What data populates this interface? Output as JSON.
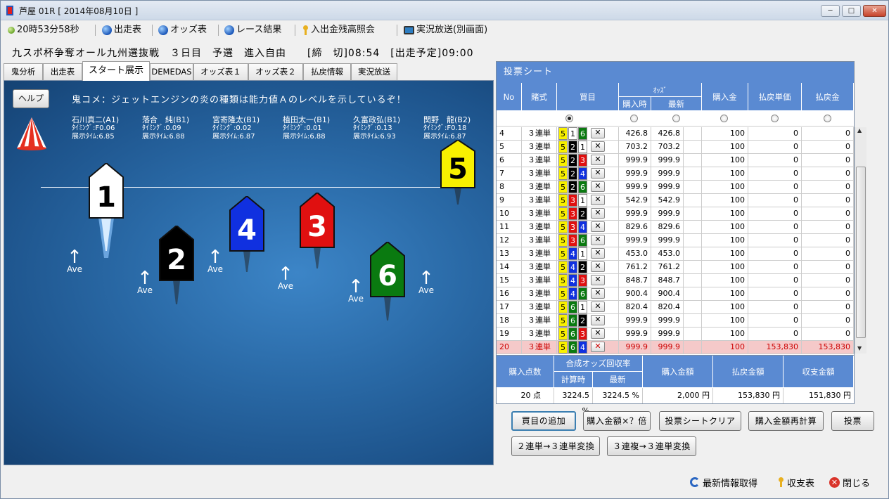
{
  "window": {
    "title": "芦屋 01R [ 2014年08月10日 ]",
    "min": "─",
    "max": "□",
    "close": "✕"
  },
  "toolbar": {
    "clock": "20時53分58秒",
    "entry_table": "出走表",
    "odds_table": "オッズ表",
    "race_result": "レース結果",
    "balance": "入出金残高照会",
    "live": "実況放送(別画面)"
  },
  "race_info": "九スポ杯争奪オール九州選抜戦　３日目　予選　進入自由　　[締　切]08:54　[出走予定]09:00",
  "tabs": [
    "鬼分析",
    "出走表",
    "スタート展示",
    "DEMEDAS",
    "オッズ表１",
    "オッズ表２",
    "払戻情報",
    "実況放送"
  ],
  "scene": {
    "help": "ヘルプ",
    "comment": "鬼コメ：ジェットエンジンの炎の種類は能力値Ａのレベルを示しているぞ！",
    "racers": [
      {
        "name": "石川真二(A1)",
        "timing": "ﾀｲﾐﾝｸﾞ:F0.06",
        "exh": "展示ﾀｲﾑ:6.85"
      },
      {
        "name": "落合　純(B1)",
        "timing": "ﾀｲﾐﾝｸﾞ:0.09",
        "exh": "展示ﾀｲﾑ:6.88"
      },
      {
        "name": "宮寄隆太(B1)",
        "timing": "ﾀｲﾐﾝｸﾞ:0.02",
        "exh": "展示ﾀｲﾑ:6.87"
      },
      {
        "name": "植田太一(B1)",
        "timing": "ﾀｲﾐﾝｸﾞ:0.01",
        "exh": "展示ﾀｲﾑ:6.88"
      },
      {
        "name": "久富政弘(B1)",
        "timing": "ﾀｲﾐﾝｸﾞ:0.13",
        "exh": "展示ﾀｲﾑ:6.93"
      },
      {
        "name": "関野　龍(B2)",
        "timing": "ﾀｲﾐﾝｸﾞ:F0.18",
        "exh": "展示ﾀｲﾑ:6.87"
      }
    ],
    "boats": [
      "1",
      "2",
      "3",
      "4",
      "5",
      "6"
    ],
    "ave": "Ave"
  },
  "sheet": {
    "title": "投票シート",
    "headers": {
      "no": "No",
      "type": "賭式",
      "combo": "買目",
      "odds": "ｵｯｽﾞ",
      "odds_buy": "購入時",
      "odds_new": "最新",
      "amount": "購入金",
      "unit": "払戻単価",
      "payout": "払戻金"
    },
    "rows": [
      {
        "no": "4",
        "type": "３連単",
        "a": "5",
        "b": "1",
        "c": "6",
        "buy": "426.8",
        "new": "426.8",
        "amt": "100",
        "unit": "0",
        "pay": "0"
      },
      {
        "no": "5",
        "type": "３連単",
        "a": "5",
        "b": "2",
        "c": "1",
        "buy": "703.2",
        "new": "703.2",
        "amt": "100",
        "unit": "0",
        "pay": "0"
      },
      {
        "no": "6",
        "type": "３連単",
        "a": "5",
        "b": "2",
        "c": "3",
        "buy": "999.9",
        "new": "999.9",
        "amt": "100",
        "unit": "0",
        "pay": "0"
      },
      {
        "no": "7",
        "type": "３連単",
        "a": "5",
        "b": "2",
        "c": "4",
        "buy": "999.9",
        "new": "999.9",
        "amt": "100",
        "unit": "0",
        "pay": "0"
      },
      {
        "no": "8",
        "type": "３連単",
        "a": "5",
        "b": "2",
        "c": "6",
        "buy": "999.9",
        "new": "999.9",
        "amt": "100",
        "unit": "0",
        "pay": "0"
      },
      {
        "no": "9",
        "type": "３連単",
        "a": "5",
        "b": "3",
        "c": "1",
        "buy": "542.9",
        "new": "542.9",
        "amt": "100",
        "unit": "0",
        "pay": "0"
      },
      {
        "no": "10",
        "type": "３連単",
        "a": "5",
        "b": "3",
        "c": "2",
        "buy": "999.9",
        "new": "999.9",
        "amt": "100",
        "unit": "0",
        "pay": "0"
      },
      {
        "no": "11",
        "type": "３連単",
        "a": "5",
        "b": "3",
        "c": "4",
        "buy": "829.6",
        "new": "829.6",
        "amt": "100",
        "unit": "0",
        "pay": "0"
      },
      {
        "no": "12",
        "type": "３連単",
        "a": "5",
        "b": "3",
        "c": "6",
        "buy": "999.9",
        "new": "999.9",
        "amt": "100",
        "unit": "0",
        "pay": "0"
      },
      {
        "no": "13",
        "type": "３連単",
        "a": "5",
        "b": "4",
        "c": "1",
        "buy": "453.0",
        "new": "453.0",
        "amt": "100",
        "unit": "0",
        "pay": "0"
      },
      {
        "no": "14",
        "type": "３連単",
        "a": "5",
        "b": "4",
        "c": "2",
        "buy": "761.2",
        "new": "761.2",
        "amt": "100",
        "unit": "0",
        "pay": "0"
      },
      {
        "no": "15",
        "type": "３連単",
        "a": "5",
        "b": "4",
        "c": "3",
        "buy": "848.7",
        "new": "848.7",
        "amt": "100",
        "unit": "0",
        "pay": "0"
      },
      {
        "no": "16",
        "type": "３連単",
        "a": "5",
        "b": "4",
        "c": "6",
        "buy": "900.4",
        "new": "900.4",
        "amt": "100",
        "unit": "0",
        "pay": "0"
      },
      {
        "no": "17",
        "type": "３連単",
        "a": "5",
        "b": "6",
        "c": "1",
        "buy": "820.4",
        "new": "820.4",
        "amt": "100",
        "unit": "0",
        "pay": "0"
      },
      {
        "no": "18",
        "type": "３連単",
        "a": "5",
        "b": "6",
        "c": "2",
        "buy": "999.9",
        "new": "999.9",
        "amt": "100",
        "unit": "0",
        "pay": "0"
      },
      {
        "no": "19",
        "type": "３連単",
        "a": "5",
        "b": "6",
        "c": "3",
        "buy": "999.9",
        "new": "999.9",
        "amt": "100",
        "unit": "0",
        "pay": "0"
      },
      {
        "no": "20",
        "type": "３連単",
        "a": "5",
        "b": "6",
        "c": "4",
        "buy": "999.9",
        "new": "999.9",
        "amt": "100",
        "unit": "153,830",
        "pay": "153,830",
        "hit": true
      }
    ],
    "x": "✕"
  },
  "lane_colors": {
    "1": "#ffffff",
    "2": "#000000",
    "3": "#e01010",
    "4": "#1030e0",
    "5": "#f8f000",
    "6": "#0a7a10"
  },
  "summary": {
    "h_points": "購入点数",
    "h_rate": "合成オッズ回収率",
    "h_rate_calc": "計算時",
    "h_rate_new": "最新",
    "h_total": "購入金額",
    "h_payout": "払戻金額",
    "h_balance": "収支金額",
    "points": "20 点",
    "rate_calc": "3224.5 %",
    "rate_new": "3224.5 %",
    "total": "2,000 円",
    "payout": "153,830 円",
    "balance": "151,830 円"
  },
  "buttons": {
    "add": "買目の追加",
    "multiply": "購入金額×？倍",
    "clear": "投票シートクリア",
    "recalc": "購入金額再計算",
    "vote": "投票",
    "conv2": "２連単→３連単変換",
    "conv3": "３連複→３連単変換"
  },
  "footer": {
    "refresh": "最新情報取得",
    "ledger": "収支表",
    "close": "閉じる"
  }
}
